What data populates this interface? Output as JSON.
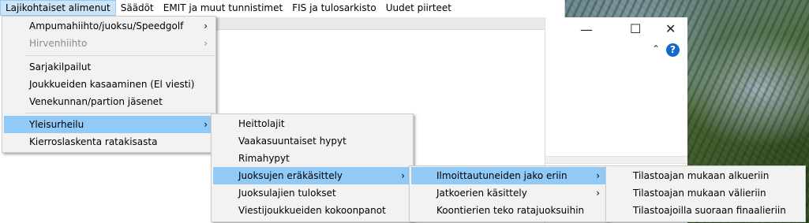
{
  "menubar": [
    {
      "label": "Lajikohtaiset alimenut",
      "active": true
    },
    {
      "label": "Säädöt"
    },
    {
      "label": "EMIT ja muut tunnistimet"
    },
    {
      "label": "FIS ja tulosarkisto"
    },
    {
      "label": "Uudet piirteet"
    }
  ],
  "menu1": {
    "items": [
      {
        "label": "Ampumahiihto/juoksu/Speedgolf",
        "submenu": true
      },
      {
        "label": "Hirvenhiihto",
        "submenu": true,
        "disabled": true
      },
      {
        "label": "Sarjakilpailut"
      },
      {
        "label": "Joukkueiden kasaaminen (El viesti)"
      },
      {
        "label": "Venekunnan/partion jäsenet"
      },
      {
        "label": "Yleisurheilu",
        "submenu": true,
        "highlighted": true
      },
      {
        "label": "Kierroslaskenta ratakisasta"
      }
    ]
  },
  "menu2": {
    "items": [
      {
        "label": "Heittolajit"
      },
      {
        "label": "Vaakasuuntaiset hypyt"
      },
      {
        "label": "Rimahypyt"
      },
      {
        "label": "Juoksujen eräkäsittely",
        "submenu": true,
        "highlighted": true
      },
      {
        "label": "Juoksulajien tulokset"
      },
      {
        "label": "Viestijoukkueiden kokoonpanot"
      }
    ]
  },
  "menu3": {
    "items": [
      {
        "label": "Ilmoittautuneiden jako eriin",
        "submenu": true,
        "highlighted": true
      },
      {
        "label": "Jatkoerien käsittely",
        "submenu": true
      },
      {
        "label": "Koontierien teko ratajuoksuihin"
      }
    ]
  },
  "menu4": {
    "items": [
      {
        "label": "Tilastoajan mukaan alkueriin"
      },
      {
        "label": "Tilastoajan mukaan välieriin"
      },
      {
        "label": "Tilastoajoilla suoraan finaalieriin"
      }
    ]
  },
  "glyphs": {
    "arrow": "›",
    "minimize": "—",
    "maximize": "☐",
    "close": "✕",
    "help": "?",
    "chevron_up": "⌃",
    "scroll_up": "▲"
  },
  "colors": {
    "highlight": "#91c9f7",
    "menu_bg": "#f2f2f2",
    "menubar_active": "#cce4f7"
  }
}
